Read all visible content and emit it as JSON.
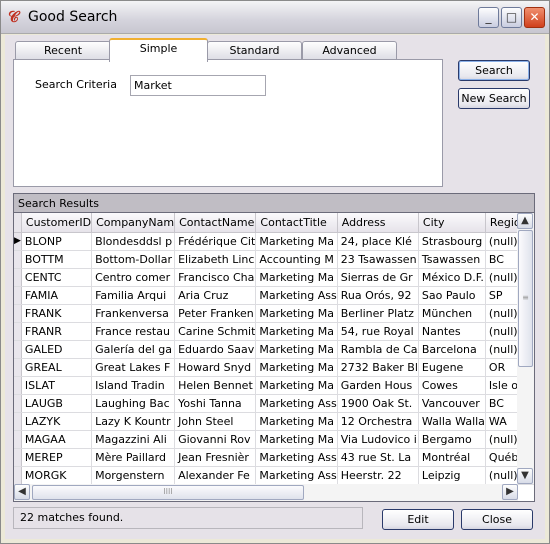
{
  "window": {
    "title": "Good Search",
    "minimize": "_",
    "maximize": "□",
    "close": "✕"
  },
  "tabs": [
    {
      "label": "Recent",
      "active": false
    },
    {
      "label": "Simple",
      "active": true
    },
    {
      "label": "Standard",
      "active": false
    },
    {
      "label": "Advanced",
      "active": false
    }
  ],
  "criteria": {
    "label": "Search Criteria",
    "value": "Market"
  },
  "buttons": {
    "search": "Search",
    "new_search": "New Search",
    "edit": "Edit",
    "close": "Close"
  },
  "results": {
    "caption": "Search Results",
    "columns": [
      "CustomerID",
      "CompanyNam",
      "ContactName",
      "ContactTitle",
      "Address",
      "City",
      "Regior"
    ],
    "rows": [
      [
        "BLONP",
        "Blondesddsl p",
        "Frédérique Cit",
        "Marketing Ma",
        "24, place Klé",
        "Strasbourg",
        "(null)"
      ],
      [
        "BOTTM",
        "Bottom-Dollar",
        "Elizabeth Linc",
        "Accounting M",
        "23 Tsawassen",
        "Tsawassen",
        "BC"
      ],
      [
        "CENTC",
        "Centro comer",
        "Francisco Cha",
        "Marketing Ma",
        "Sierras de Gr",
        "México D.F.",
        "(null)"
      ],
      [
        "FAMIA",
        "Familia Arqui",
        "Aria Cruz",
        "Marketing Ass",
        "Rua Orós, 92",
        "Sao Paulo",
        "SP"
      ],
      [
        "FRANK",
        "Frankenversa",
        "Peter Franken",
        "Marketing Ma",
        "Berliner Platz",
        "München",
        "(null)"
      ],
      [
        "FRANR",
        "France restau",
        "Carine Schmit",
        "Marketing Ma",
        "54, rue Royal",
        "Nantes",
        "(null)"
      ],
      [
        "GALED",
        "Galería del ga",
        "Eduardo Saav",
        "Marketing Ma",
        "Rambla de Ca",
        "Barcelona",
        "(null)"
      ],
      [
        "GREAL",
        "Great Lakes F",
        "Howard Snyd",
        "Marketing Ma",
        "2732 Baker Bl",
        "Eugene",
        "OR"
      ],
      [
        "ISLAT",
        "Island Tradin",
        "Helen Bennet",
        "Marketing Ma",
        "Garden Hous",
        "Cowes",
        "Isle of"
      ],
      [
        "LAUGB",
        "Laughing Bac",
        "Yoshi Tanna",
        "Marketing Ass",
        "1900 Oak St.",
        "Vancouver",
        "BC"
      ],
      [
        "LAZYK",
        "Lazy K Kountr",
        "John Steel",
        "Marketing Ma",
        "12 Orchestra",
        "Walla Walla",
        "WA"
      ],
      [
        "MAGAA",
        "Magazzini Ali",
        "Giovanni Rov",
        "Marketing Ma",
        "Via Ludovico i",
        "Bergamo",
        "(null)"
      ],
      [
        "MEREP",
        "Mère Paillard",
        "Jean Fresnièr",
        "Marketing Ass",
        "43 rue St. La",
        "Montréal",
        "Québec"
      ],
      [
        "MORGK",
        "Morgenstern",
        "Alexander Fe",
        "Marketing Ass",
        "Heerstr. 22",
        "Leipzig",
        "(null)"
      ]
    ],
    "current_row_marker": "▶"
  },
  "status": {
    "text": "22 matches found."
  }
}
